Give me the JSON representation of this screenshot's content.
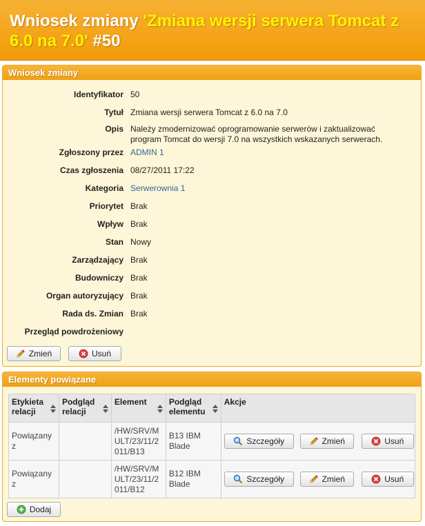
{
  "page": {
    "title_prefix": "Wniosek zmiany ",
    "title_highlight": "'Zmiana wersji serwera Tomcat z 6.0 na 7.0'",
    "title_suffix": " #50"
  },
  "change_panel": {
    "heading": "Wniosek zmiany",
    "fields": [
      {
        "label": "Identyfikator",
        "value": "50"
      },
      {
        "label": "Tytuł",
        "value": "Zmiana wersji serwera Tomcat z 6.0 na 7.0"
      },
      {
        "label": "Opis",
        "value": "Należy zmodernizować oprogramowanie serwerów i zaktualizować program Tomcat do wersji 7.0 na wszystkich wskazanych serwerach."
      },
      {
        "label": "Zgłoszony przez",
        "value": "ADMIN 1"
      },
      {
        "label": "Czas zgłoszenia",
        "value": "08/27/2011 17:22"
      },
      {
        "label": "Kategoria",
        "value": "Serwerownia 1"
      },
      {
        "label": "Priorytet",
        "value": "Brak"
      },
      {
        "label": "Wpływ",
        "value": "Brak"
      },
      {
        "label": "Stan",
        "value": "Nowy"
      },
      {
        "label": "Zarządzający",
        "value": "Brak"
      },
      {
        "label": "Budowniczy",
        "value": "Brak"
      },
      {
        "label": "Organ autoryzujący",
        "value": "Brak"
      },
      {
        "label": "Rada ds. Zmian",
        "value": "Brak"
      },
      {
        "label": "Przegląd powdrożeniowy",
        "value": ""
      }
    ],
    "edit_label": "Zmień",
    "delete_label": "Usuń"
  },
  "related_panel": {
    "heading": "Elementy powiązane",
    "columns": [
      "Etykieta relacji",
      "Podgląd relacji",
      "Element",
      "Podgląd elementu",
      "Akcje"
    ],
    "rows": [
      {
        "relation": "Powiązany z",
        "relation_preview": "",
        "element": "/HW/SRV/MULT/23/11/2011/B13",
        "element_preview": "B13 IBM Blade"
      },
      {
        "relation": "Powiązany z",
        "relation_preview": "",
        "element": "/HW/SRV/MULT/23/11/2011/B12",
        "element_preview": "B12 IBM Blade"
      }
    ],
    "details_label": "Szczegóły",
    "edit_label": "Zmień",
    "delete_label": "Usuń",
    "add_label": "Dodaj"
  },
  "colors": {
    "header": "#f29a08",
    "title_highlight": "#fff200",
    "link": "#336699",
    "panel_bg": "#fdf6d8"
  }
}
